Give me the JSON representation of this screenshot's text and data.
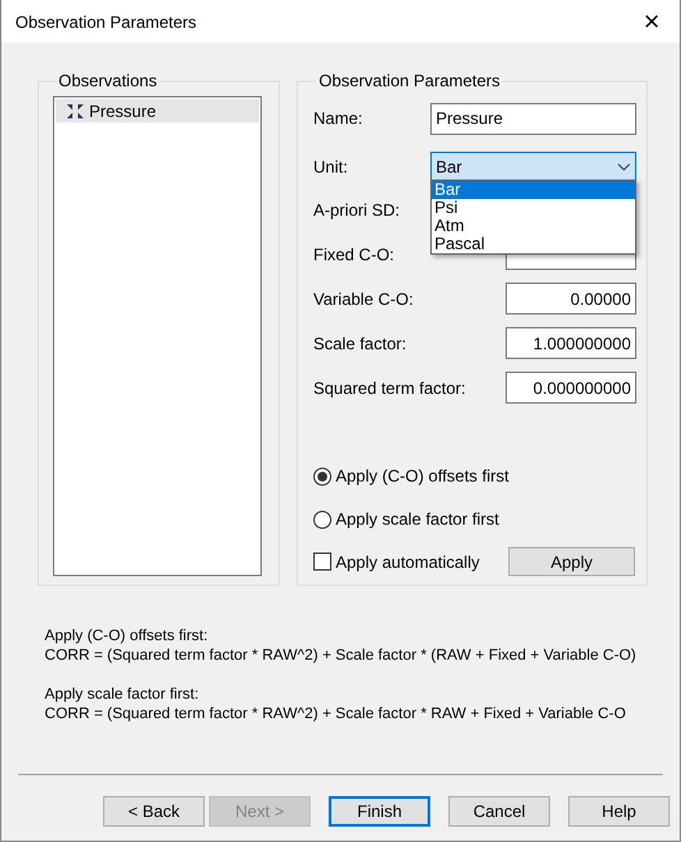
{
  "window": {
    "title": "Observation Parameters",
    "close": "×"
  },
  "observations": {
    "title": "Observations",
    "items": [
      {
        "label": "Pressure",
        "selected": true
      }
    ]
  },
  "parameters": {
    "title": "Observation Parameters",
    "name": {
      "label": "Name:",
      "value": "Pressure"
    },
    "unit": {
      "label": "Unit:",
      "value": "Bar",
      "expanded": true,
      "options": [
        {
          "label": "Bar",
          "selected": true
        },
        {
          "label": "Psi",
          "selected": false
        },
        {
          "label": "Atm",
          "selected": false
        },
        {
          "label": "Pascal",
          "selected": false
        }
      ]
    },
    "apriori_sd": {
      "label": "A-priori SD:"
    },
    "fields": [
      {
        "label": "Fixed C-O:"
      },
      {
        "label": "Variable C-O:",
        "value": "0.00000"
      },
      {
        "label": "Scale factor:",
        "value": "1.000000000"
      },
      {
        "label": "Squared term factor:",
        "value": "0.000000000"
      }
    ],
    "order": [
      {
        "label": "Apply (C-O) offsets first",
        "selected": true
      },
      {
        "label": "Apply scale factor first",
        "selected": false
      }
    ],
    "auto_apply": {
      "label": "Apply automatically",
      "checked": false
    },
    "apply_button": "Apply"
  },
  "formulas": [
    {
      "title": "Apply (C-O) offsets first:",
      "formula": "CORR = (Squared term factor * RAW^2) + Scale factor * (RAW + Fixed + Variable C-O)"
    },
    {
      "title": "Apply scale factor first:",
      "formula": "CORR = (Squared term factor * RAW^2) + Scale factor * RAW + Fixed + Variable C-O"
    }
  ],
  "buttons": [
    {
      "label": "< Back",
      "disabled": false,
      "default": false
    },
    {
      "label": "Next >",
      "disabled": true,
      "default": false
    },
    {
      "label": "Finish",
      "disabled": false,
      "default": true
    },
    {
      "label": "Cancel",
      "disabled": false,
      "default": false
    },
    {
      "label": "Help",
      "disabled": false,
      "default": false
    }
  ]
}
